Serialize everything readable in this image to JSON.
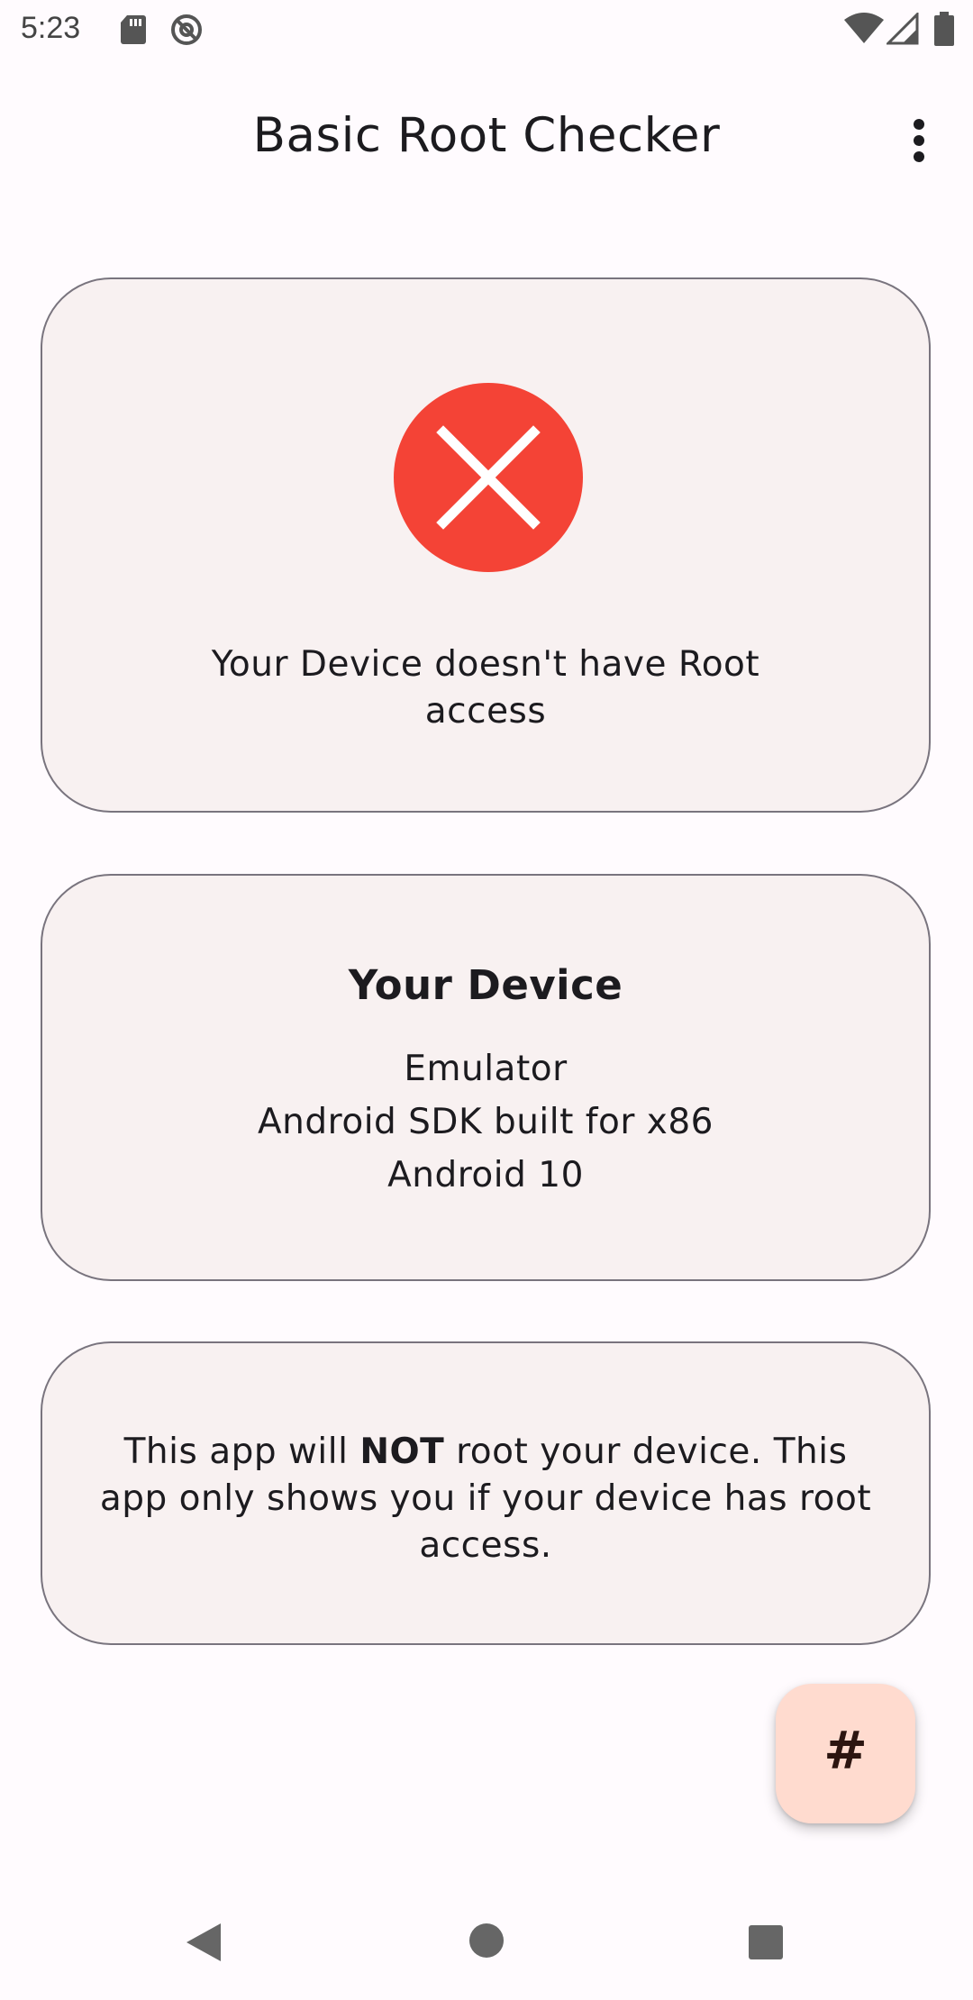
{
  "status_bar": {
    "time": "5:23",
    "left_icons": [
      "sd-card-icon",
      "no-tracking-icon"
    ],
    "right_icons": [
      "wifi-icon",
      "signal-icon",
      "battery-icon"
    ]
  },
  "app_bar": {
    "title": "Basic Root Checker",
    "menu_icon": "more-vert-icon"
  },
  "root_status_card": {
    "icon": "error-x-icon",
    "icon_color": "#F44336",
    "message": "Your Device doesn't have Root access"
  },
  "device_card": {
    "heading": "Your Device",
    "device_type": "Emulator",
    "model": "Android SDK built for x86",
    "os_version": "Android 10"
  },
  "disclaimer_card": {
    "prefix": "This app will ",
    "emphasis": "NOT",
    "suffix": " root your device. This app only shows you if your device has root access."
  },
  "fab": {
    "glyph": "#",
    "icon": "hashtag-icon",
    "color": "#FFDBCF"
  },
  "nav_bar": {
    "buttons": [
      "back-icon",
      "home-icon",
      "recents-icon"
    ]
  },
  "colors": {
    "background": "#FFFBFE",
    "card_background": "#F8F1F1",
    "card_border": "#79747E",
    "error_red": "#F44336"
  }
}
